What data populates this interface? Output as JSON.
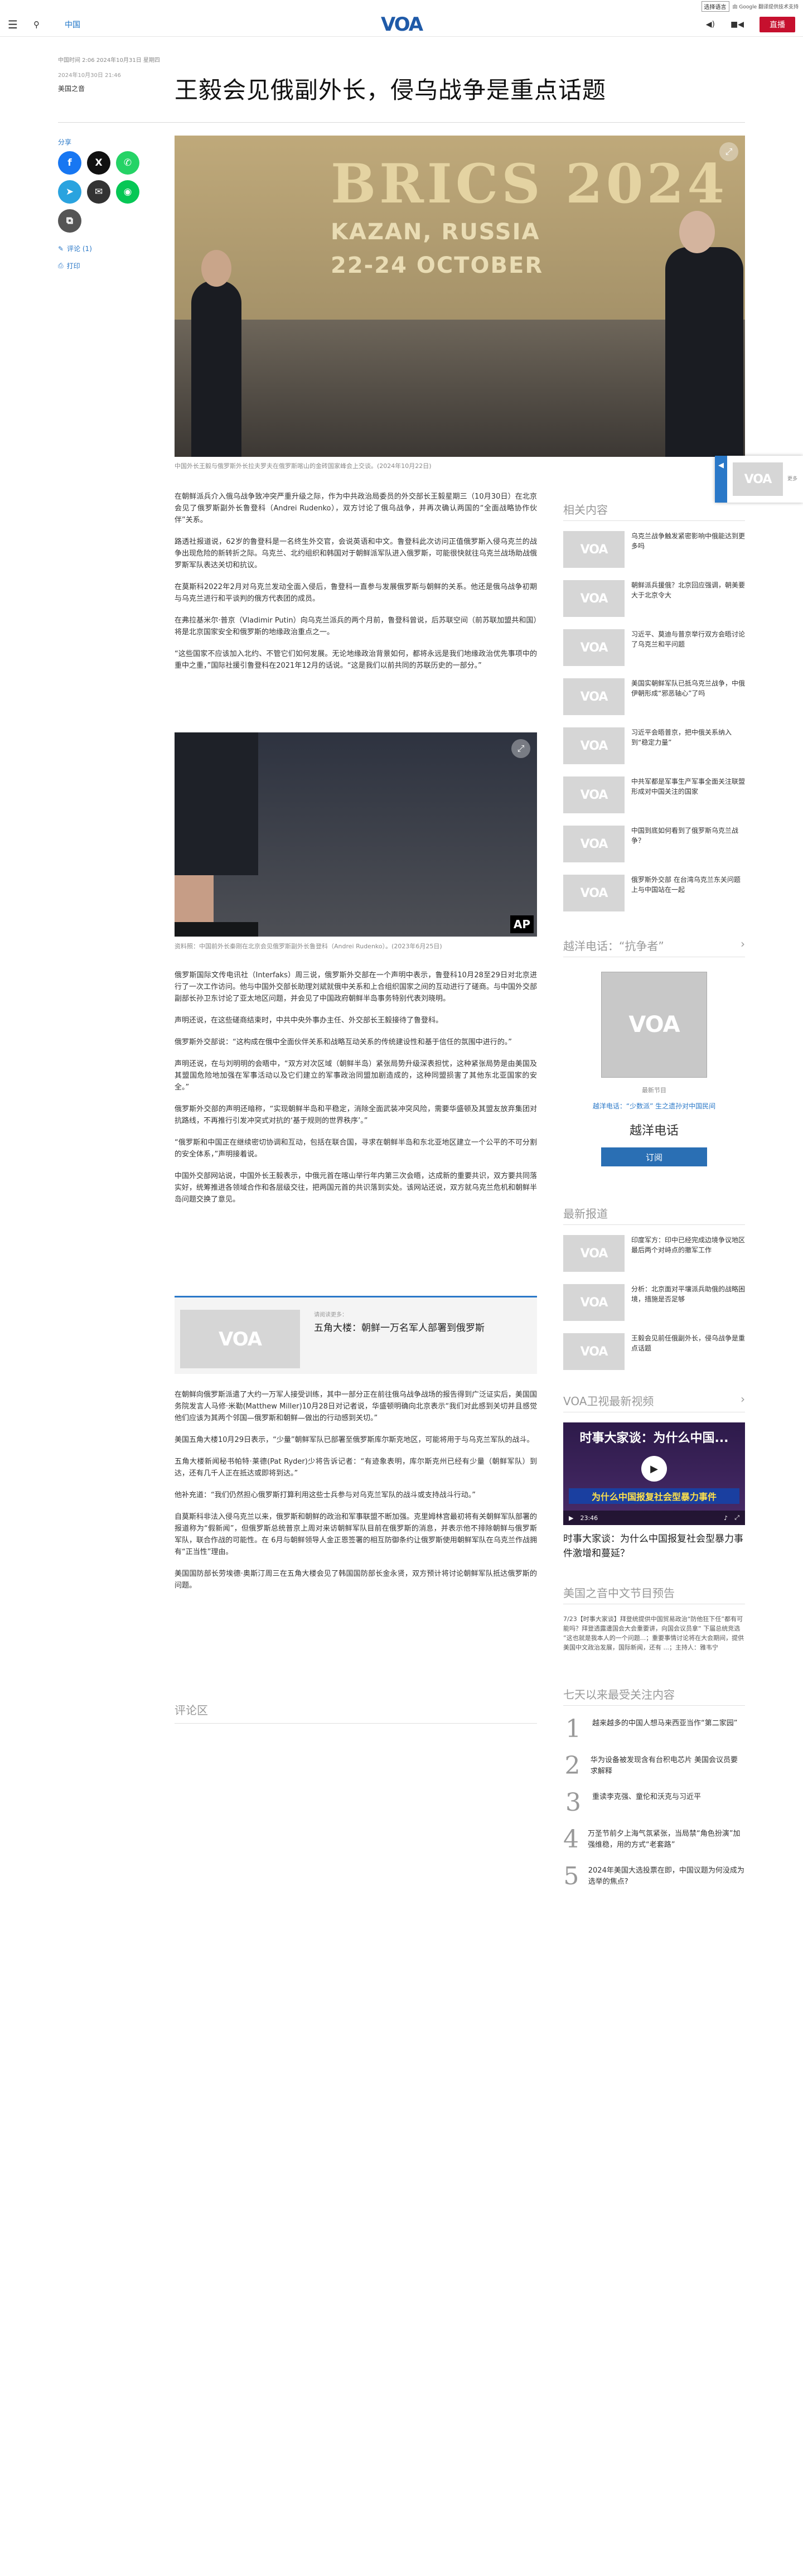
{
  "translate": {
    "label": "选择语言",
    "powered": "由 Google 翻译提供技术支持"
  },
  "header": {
    "section": "中国",
    "logo": "VOA",
    "live": "直播"
  },
  "article": {
    "published": "中国时间 2:06 2024年10月31日 星期四",
    "updated": "2024年10月30日 21:46",
    "category": "美国之音",
    "headline": "王毅会见俄副外长，侵乌战争是重点话题",
    "hero_overlay": {
      "line1": "BRICS 2024",
      "line2": "KAZAN, RUSSIA",
      "line3": "22-24 OCTOBER"
    },
    "hero_caption": "中国外长王毅与俄罗斯外长拉夫罗夫在俄罗斯喀山的金砖国家峰会上交谈。(2024年10月22日)",
    "paragraphs": [
      "在朝鲜派兵介入俄乌战争致冲突严重升级之际，作为中共政治局委员的外交部长王毅星期三（10月30日）在北京会见了俄罗斯副外长鲁登科（Andrei Rudenko），双方讨论了俄乌战争，并再次确认两国的“全面战略协作伙伴”关系。",
      "路透社报道说，62岁的鲁登科是一名终生外交官，会说英语和中文。鲁登科此次访问正值俄罗斯入侵乌克兰的战争出现危险的新转折之际。乌克兰、北约组织和韩国对于朝鲜派军队进入俄罗斯，可能很快就往乌克兰战场助战俄罗斯军队表达关切和抗议。",
      "在莫斯科2022年2月对乌克兰发动全面入侵后，鲁登科一直参与发展俄罗斯与朝鲜的关系。他还是俄乌战争初期与乌克兰进行和平谈判的俄方代表团的成员。",
      "在弗拉基米尔·普京（Vladimir Putin）向乌克兰派兵的两个月前，鲁登科曾说，后苏联空间（前苏联加盟共和国）将是北京国家安全和俄罗斯的地缘政治重点之一。",
      "“这些国家不应该加入北约、不管它们如何发展。无论地缘政治背景如何，都将永远是我们地缘政治优先事项中的重中之重，”国际社援引鲁登科在2021年12月的话说。“这是我们以前共同的苏联历史的一部分。”"
    ],
    "img2_caption": "资料照：中国前外长秦刚在北京会见俄罗斯副外长鲁登科（Andrei Rudenko）。(2023年6月25日)",
    "img2_credit": "AP",
    "paragraphs2": [
      "俄罗斯国际文传电讯社（Interfaks）周三说，俄罗斯外交部在一个声明中表示，鲁登科10月28至29日对北京进行了一次工作访问。他与中国外交部长助理刘斌就俄中关系和上合组织国家之间的互动进行了磋商。与中国外交部副部长孙卫东讨论了亚太地区问题，并会见了中国政府朝鲜半岛事务特别代表刘晓明。",
      "声明还说，在这些磋商结束时，中共中央外事办主任、外交部长王毅接待了鲁登科。",
      "俄罗斯外交部说：“这构成在俄中全面伙伴关系和战略互动关系的传统建设性和基于信任的氛围中进行的。”",
      "声明还说，在与刘明明的会晤中，“双方对次区域（朝鲜半岛）紧张局势升级深表担忧，这种紧张局势是由美国及其盟国危险地加强在军事活动以及它们建立的军事政治同盟加剧造成的，这种同盟损害了其他东北亚国家的安全。”",
      "俄罗斯外交部的声明还暗称，“实现朝鲜半岛和平稳定，消除全面武装冲突风险，需要华盛顿及其盟友放弃集团对抗路线，不再推行引发冲突式对抗的‘基于规则的世界秩序’。”",
      "“俄罗斯和中国正在继续密切协调和互动，包括在联合国，寻求在朝鲜半岛和东北亚地区建立一个公平的不可分割的安全体系，”声明接着说。",
      "中国外交部网站说，中国外长王毅表示，中俄元首在喀山举行年内第三次会晤，达成新的重要共识，双方要共同落实好，统筹推进各领域合作和各层级交往，把两国元首的共识落到实处。该网站还说，双方就乌克兰危机和朝鲜半岛问题交换了意见。"
    ],
    "related": {
      "kicker": "请阅读更多：",
      "title": "五角大楼：朝鲜一万名军人部署到俄罗斯"
    },
    "paragraphs3": [
      "在朝鲜向俄罗斯派遣了大约一万军人接受训练，其中一部分正在前往俄乌战争战场的报告得到广泛证实后，美国国务院发言人马修·米勒(Matthew Miller)10月28日对记者说，华盛顿明确向北京表示“我们对此感到关切并且感觉他们应该为其两个邻国—俄罗斯和朝鲜—做出的行动感到关切。”",
      "美国五角大楼10月29日表示，“少量”朝鲜军队已部署至俄罗斯库尔斯克地区，可能将用于与乌克兰军队的战斗。",
      "五角大楼新闻秘书帕特·莱德(Pat Ryder)少将告诉记者：“有迹象表明，库尔斯克州已经有少量（朝鲜军队）到达，还有几千人正在抵达或即将到达。”",
      "他补充道：“我们仍然担心俄罗斯打算利用这些士兵参与对乌克兰军队的战斗或支持战斗行动。”",
      "自莫斯科非法入侵乌克兰以来，俄罗斯和朝鲜的政治和军事联盟不断加强。克里姆林宫最初将有关朝鲜军队部署的报道称为“假新闻”，但俄罗斯总统普京上周对来访朝鲜军队目前在俄罗斯的消息，并表示他不排除朝鲜与俄罗斯军队，联合作战的可能性。在 6月与朝鲜领导人金正恩签署的相互防御条约让俄罗斯使用朝鲜军队在乌克兰作战拥有“正当性”理由。",
      "美国国防部长劳埃德·奥斯汀周三在五角大楼会见了韩国国防部长金永贤，双方预计将讨论朝鲜军队抵达俄罗斯的问题。"
    ],
    "comments": "评论区"
  },
  "share": {
    "label": "分享",
    "comment_link": "评论 (1)",
    "print_link": "打印"
  },
  "floating": {
    "more": "更多"
  },
  "sidebar": {
    "related_title": "相关内容",
    "related": [
      "乌克兰战争触发紧密影响中俄能达到更多吗",
      "朝鲜派兵援俄？北京回应强调，朝美要大于北京令大",
      "习近平、莫迪与普京举行双方会晤讨论了乌克兰和平问题",
      "美国实朝鲜军队已抵乌克兰战争，中俄伊朝形成“邪恶轴心”了吗",
      "习近平会晤普京，把中俄关系纳入到“稳定力量”",
      "中共军都是军事生产军事全面关注联盟形成对中国关注的国家",
      "中国到底如何看到了俄罗斯乌克兰战争？",
      "俄罗斯外交部 在台湾乌克兰东关问题上与中国站在一起"
    ],
    "podcast_title": "越洋电话：“抗争者”",
    "podcast_latest": "最新节目",
    "podcast_links": "越洋电话：“少数派”  生之遗孙对中国民间",
    "podcast_name": "越洋电话",
    "subscribe": "订阅",
    "latest_title": "最新报道",
    "latest": [
      "印度军方：印中已经完成边境争议地区最后两个对峙点的撤军工作",
      "分析：北京面对平壤派兵助俄的战略困境，措施是否足够",
      "王毅会见前任俄副外长，侵乌战争是重点话题"
    ],
    "video_title": "VOA卫视最新视频",
    "video_overlay": "时事大家谈：为什么中国...",
    "video_band": "为什么中国报复社会型暴力事件",
    "video_time": "23:46",
    "video_caption": "时事大家谈：为什么中国报复社会型暴力事件激增和蔓延？",
    "preview_title": "美国之音中文节目预告",
    "preview_text": "7/23【时事大家谈】拜登统提供中国贸易政治“防他狂下任”都有可能吗？拜登透露遭国会大会重要讲，向国会议员拿“ 下届总统竞选 ”这也就是我本人的一个问题...；重要事情讨论将在大会期间，提供美国中文政治发展，国际新闻，还有 ...；主持人：雅韦宁",
    "popular_title": "七天以来最受关注内容",
    "popular": [
      "越来越多的中国人想马来西亚当作“第二家园”",
      "华为设备被发现含有台积电芯片 美国会议员要求解释",
      "重读李克强、童伦和沃克与习近平",
      "万圣节前夕上海气氛紧张，当局禁“角色扮演”加强维稳，用的方式“老套路”",
      "2024年美国大选投票在即，中国议题为何没成为选举的焦点?"
    ]
  }
}
